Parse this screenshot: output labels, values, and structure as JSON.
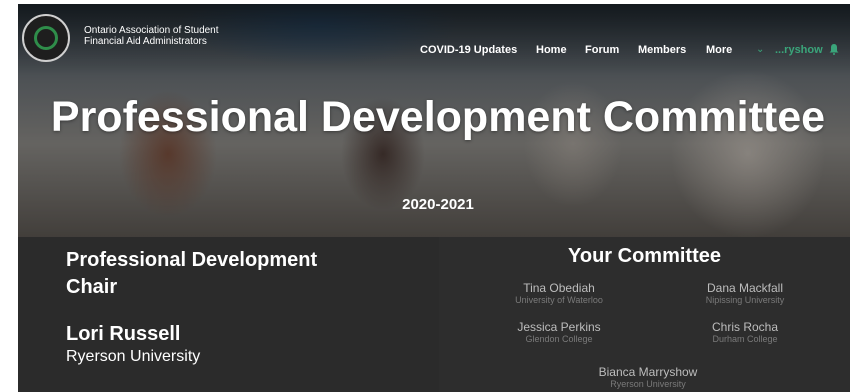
{
  "header": {
    "org_name": "Ontario Association of Student Financial Aid Administrators",
    "nav": [
      "COVID-19 Updates",
      "Home",
      "Forum",
      "Members",
      "More"
    ],
    "user_name": "...ryshow"
  },
  "hero": {
    "title": "Professional Development Committee",
    "years": "2020-2021"
  },
  "chair": {
    "heading": "Professional Development Chair",
    "name": "Lori Russell",
    "school": "Ryerson University"
  },
  "committee": {
    "title": "Your Committee",
    "members": [
      {
        "name": "Tina Obediah",
        "school": "University of Waterloo"
      },
      {
        "name": "Dana Mackfall",
        "school": "Nipissing University"
      },
      {
        "name": "Jessica Perkins",
        "school": "Glendon College"
      },
      {
        "name": "Chris Rocha",
        "school": "Durham College"
      },
      {
        "name": "Bianca Marryshow",
        "school": "Ryerson University"
      }
    ]
  },
  "colors": {
    "accent": "#3aa57a",
    "panel": "#2b2b2b"
  },
  "icons": [
    "association-logo-icon",
    "chevron-down-icon",
    "bell-icon"
  ]
}
